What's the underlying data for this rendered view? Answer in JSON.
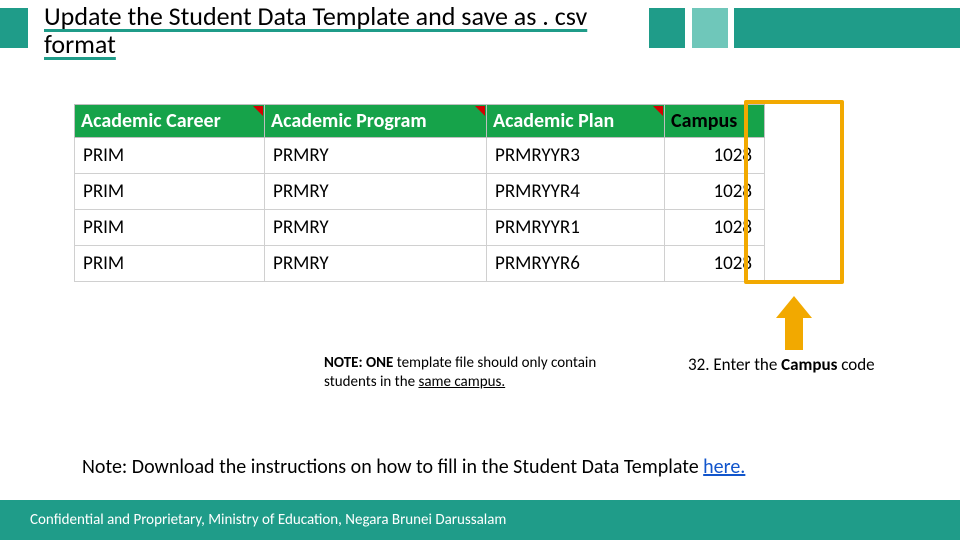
{
  "title": "Update the Student Data Template and save as . csv format",
  "table": {
    "headers": [
      "Academic Career",
      "Academic Program",
      "Academic Plan",
      "Campus"
    ],
    "rows": [
      {
        "career": "PRIM",
        "program": "PRMRY",
        "plan": "PRMRYYR3",
        "campus": "1028"
      },
      {
        "career": "PRIM",
        "program": "PRMRY",
        "plan": "PRMRYYR4",
        "campus": "1028"
      },
      {
        "career": "PRIM",
        "program": "PRMRY",
        "plan": "PRMRYYR1",
        "campus": "1028"
      },
      {
        "career": "PRIM",
        "program": "PRMRY",
        "plan": "PRMRYYR6",
        "campus": "1028"
      }
    ]
  },
  "note1_a": "NOTE: ONE",
  "note1_b": " template file should only contain students in the ",
  "note1_c": "same campus.",
  "step_num": "32. ",
  "step_text_a": "Enter the ",
  "step_text_b": "Campus",
  "step_text_c": " code",
  "note2_a": "Note: Download the instructions on how to fill in the Student Data Template ",
  "note2_link": "here.",
  "footer": "Confidential and Proprietary, Ministry of Education, Negara Brunei Darussalam"
}
